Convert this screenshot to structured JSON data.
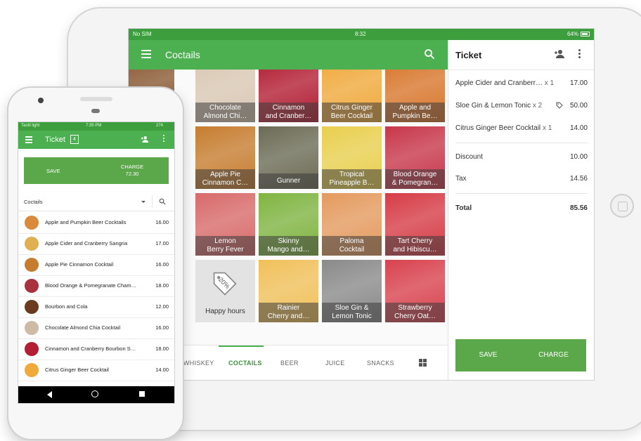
{
  "tablet": {
    "status": {
      "left": "No SIM",
      "time": "8:32",
      "battery": "64%"
    },
    "appbar": {
      "title": "Coctails",
      "menu_icon": "hamburger-icon",
      "search_icon": "search-icon"
    },
    "tiles": [
      {
        "l1": "",
        "l2": "",
        "c": "#8a5a34"
      },
      {
        "l1": "Chocolate",
        "l2": "Almond Chi…",
        "c": "#d9c7b3"
      },
      {
        "l1": "Cinnamon",
        "l2": "and Cranber…",
        "c": "#b21e33"
      },
      {
        "l1": "Citrus Ginger",
        "l2": "Beer Cocktail",
        "c": "#f0a93b"
      },
      {
        "l1": "Apple and",
        "l2": "Pumpkin Be…",
        "c": "#d8762c"
      },
      {
        "l1": "",
        "l2": "",
        "c": "#9c6a2c"
      },
      {
        "l1": "Apple Pie",
        "l2": "Cinnamon C…",
        "c": "#c67d2f"
      },
      {
        "l1": "Gunner",
        "l2": "",
        "c": "#6b6b55"
      },
      {
        "l1": "Tropical",
        "l2": "Pineapple B…",
        "c": "#e8cf4e"
      },
      {
        "l1": "Blood Orange",
        "l2": "& Pomegran…",
        "c": "#c7374a"
      },
      {
        "l1": "",
        "l2": "",
        "c": "#7a3a2a"
      },
      {
        "l1": "Lemon",
        "l2": "Berry Fever",
        "c": "#d86a6a"
      },
      {
        "l1": "Skinny",
        "l2": "Mango and…",
        "c": "#7fb441"
      },
      {
        "l1": "Paloma",
        "l2": "Cocktail",
        "c": "#e49a5e"
      },
      {
        "l1": "Tart Cherry",
        "l2": "and Hibiscu…",
        "c": "#d63c46"
      },
      {
        "l1": "",
        "l2": "",
        "c": "#f39c12"
      },
      {
        "l1": "Happy hours",
        "l2": "",
        "c": "#e3e3e3"
      },
      {
        "l1": "Rainier",
        "l2": "Cherry and…",
        "c": "#f0c05a"
      },
      {
        "l1": "Sloe Gin &",
        "l2": "Lemon Tonic",
        "c": "#8a8a8a"
      },
      {
        "l1": "Strawberry",
        "l2": "Cherry Oat…",
        "c": "#d8424e"
      }
    ],
    "discount_tile": {
      "text": "20%"
    },
    "categories": [
      {
        "label": "WHISKEY",
        "active": false
      },
      {
        "label": "COCTAILS",
        "active": true
      },
      {
        "label": "BEER",
        "active": false
      },
      {
        "label": "JUICE",
        "active": false
      },
      {
        "label": "SNACKS",
        "active": false
      }
    ],
    "ticket": {
      "title": "Ticket",
      "items": [
        {
          "name": "Apple Cider and Cranberr…",
          "qty": "x 1",
          "value": "17.00"
        },
        {
          "name": "Sloe Gin & Lemon Tonic",
          "qty": "x 2",
          "value": "50.00"
        },
        {
          "name": "Citrus Ginger Beer Cocktail",
          "qty": "x 1",
          "value": "14.00"
        }
      ],
      "discount": {
        "label": "Discount",
        "value": "10.00"
      },
      "tax": {
        "label": "Tax",
        "value": "14.56"
      },
      "total": {
        "label": "Total",
        "value": "85.56"
      },
      "save_label": "SAVE",
      "charge_label": "CHARGE"
    }
  },
  "phone": {
    "status": {
      "left": "Tactil light",
      "time": "7:35 PM",
      "right": "274"
    },
    "appbar": {
      "title": "Ticket",
      "badge": "4"
    },
    "save_label": "SAVE",
    "charge_label": "CHARGE",
    "charge_amount": "72.30",
    "filter_label": "Coctails",
    "items": [
      {
        "name": "Apple and Pumpkin Beer Cocktails",
        "value": "16.00",
        "c": "#d98a3a"
      },
      {
        "name": "Apple Cider and Cranberry Sangria",
        "value": "17.00",
        "c": "#e0b050"
      },
      {
        "name": "Apple Pie Cinnamon Cocktail",
        "value": "16.00",
        "c": "#c67d2f"
      },
      {
        "name": "Blood Orange & Pomegranate Cham…",
        "value": "18.00",
        "c": "#a8323e"
      },
      {
        "name": "Bourbon and Cola",
        "value": "12.00",
        "c": "#6b3b1f"
      },
      {
        "name": "Chocolate Almond Chia Cocktail",
        "value": "16.00",
        "c": "#cdbba6"
      },
      {
        "name": "Cinnamon and Cranberry Bourbon S…",
        "value": "18.00",
        "c": "#b21e33"
      },
      {
        "name": "Citrus Ginger Beer Cocktail",
        "value": "14.00",
        "c": "#f0a93b"
      }
    ]
  },
  "colors": {
    "primary": "#4caf50",
    "primary_dark": "#3d9e3d",
    "action": "#5aa84a"
  }
}
